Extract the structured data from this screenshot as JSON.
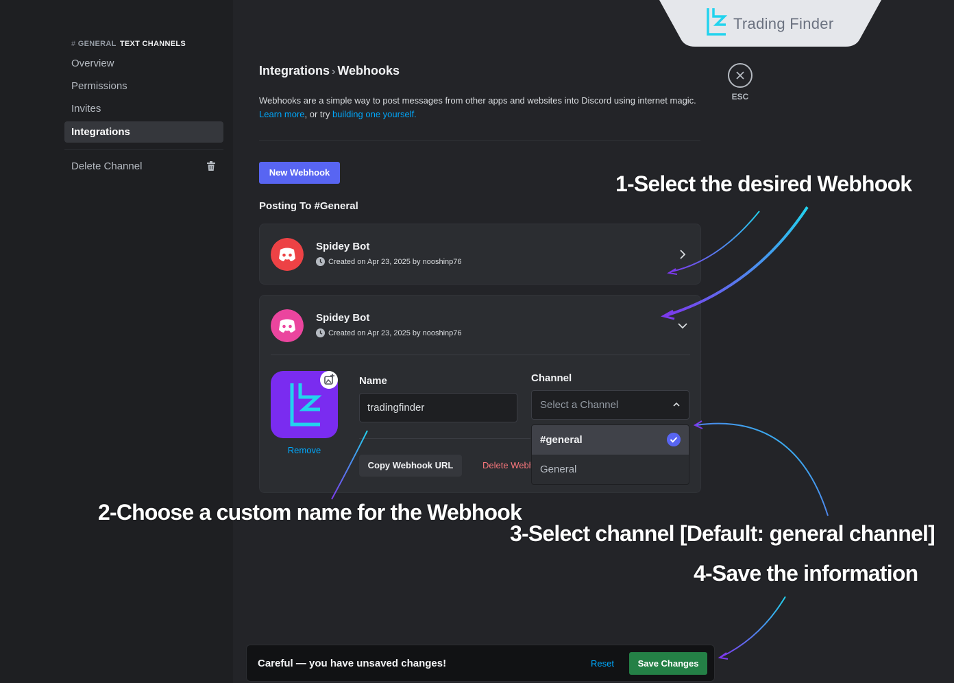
{
  "logo": {
    "text": "Trading Finder"
  },
  "sidebar": {
    "header_hash": "#",
    "header_channel": "GENERAL",
    "header_rest": "TEXT CHANNELS",
    "items": [
      {
        "label": "Overview"
      },
      {
        "label": "Permissions"
      },
      {
        "label": "Invites"
      },
      {
        "label": "Integrations",
        "active": true
      }
    ],
    "delete_label": "Delete Channel"
  },
  "header": {
    "crumb_parent": "Integrations",
    "crumb_child": "Webhooks",
    "description": "Webhooks are a simple way to post messages from other apps and websites into Discord using internet magic.",
    "learn_more": "Learn more",
    "or_try": ", or try ",
    "build_link": "building one yourself."
  },
  "esc": {
    "label": "ESC"
  },
  "new_webhook_label": "New Webhook",
  "posting_to": "Posting To #General",
  "webhooks": [
    {
      "name": "Spidey Bot",
      "meta": "Created on Apr 23, 2025 by nooshinp76",
      "color": "#ed4245"
    },
    {
      "name": "Spidey Bot",
      "meta": "Created on Apr 23, 2025 by nooshinp76",
      "color": "#eb459e"
    }
  ],
  "editor": {
    "name_label": "Name",
    "name_value": "tradingfinder",
    "channel_label": "Channel",
    "channel_placeholder": "Select a Channel",
    "options": [
      {
        "label": "#general",
        "selected": true
      },
      {
        "label": "General",
        "selected": false
      }
    ],
    "remove_label": "Remove",
    "copy_label": "Copy Webhook URL",
    "delete_label": "Delete Webhook"
  },
  "annotations": {
    "step1": "1-Select the desired Webhook",
    "step2": "2-Choose a custom name for the Webhook",
    "step3": "3-Select channel [Default: general channel]",
    "step4": "4-Save the information"
  },
  "unsaved": {
    "message": "Careful — you have unsaved changes!",
    "reset_label": "Reset",
    "save_label": "Save Changes"
  },
  "colors": {
    "accent": "#5865f2",
    "save": "#248046",
    "logo_cyan": "#22d3ee",
    "avatar_purple": "#7a2cf0"
  }
}
